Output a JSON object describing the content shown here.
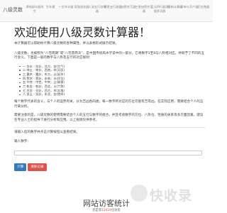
{
  "nav": {
    "brand": "八级灵数",
    "items": [
      "津暗部计器尚生",
      "生年通",
      "一生年计器",
      "奇鼓道花器",
      "人流五行游年器",
      "健恵五行游器",
      "加密交互器",
      "三恵加密交互器",
      "正元四行器通道多功器",
      "重新计算器",
      "开单公开户器",
      "后台数器"
    ]
  },
  "main": {
    "title": "欢迎使用八级灵数计算器！",
    "intro": "本计算器可以帮助你计算八级灵数的各种属性，并以表格形式展示结果。",
    "desc": "八级灵数，也被称为“八宅周期”或“八宅游周天”，是中国传统风水学说中的一部分，它将数字1至8与八卦相对应，并赋予了不同的五行含义。下面是一般的数字与八卦及五行的对应规则：",
    "mapping": [
      "一 坎水 - 坎卦，北方，金(生气)",
      "二 坤土 - 坤卦，西南，木(天医)",
      "三 震木 - 震卦，东方，土(延年)",
      "四 巽木 - 巽卦，东南，水(伏位)",
      "五 中宫 - 中宫，中央，土(祸害)",
      "六 乾金 - 乾卦，西北，火(六煞)",
      "七 兑金 - 兑卦，西方，木(五鬼)",
      "八 艮土 - 艮卦，东北，金(绝命)"
    ],
    "note1": "每个数字代表的含义，与个人的运势有关，分为吉凶各四类，每一数字所对应的方位可能有吉有凶，在实际应用，需要结合个人的五行来分析。",
    "note2": "需要注意的是，八级灵数的使用需要结合个人的五行与数字的组合，并且考虑数字的方位、八卦位、性质的关系等多方面因素，建议在专业人士的指导下进行分析和应用。以上规则仅供参考。",
    "instruction": "请输入您的数字并点击计算按钮以查看结果。",
    "input_label": "输入数字：",
    "input_value": "",
    "calc_button": "计算",
    "clear_button": "清除记录"
  },
  "stats": {
    "title": "网站访客统计",
    "footer_prefix": "您是第",
    "footer_count": "12024",
    "footer_suffix": "位访客"
  },
  "watermark": {
    "text": "快收录"
  },
  "colors": {
    "primary": "#337ab7",
    "danger": "#d9534f",
    "nav_bg": "#f8f8f8"
  }
}
